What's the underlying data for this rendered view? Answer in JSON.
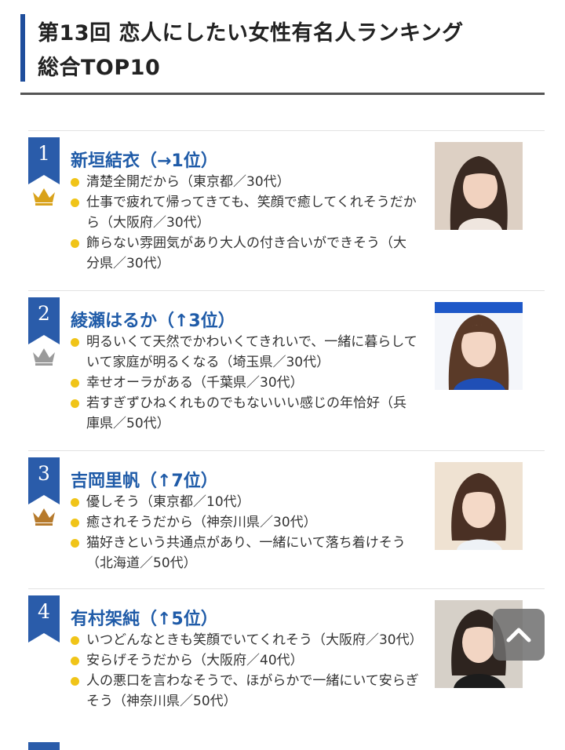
{
  "header": {
    "title_line1": "第13回 恋人にしたい女性有名人ランキング",
    "title_line2": "総合TOP10"
  },
  "colors": {
    "accent_blue": "#2a5caa",
    "name_blue": "#1f5ba8",
    "bullet_yellow": "#f0c418",
    "crown_gold": "#d9a21b",
    "crown_silver": "#9a9a9a",
    "crown_bronze": "#b67a2c"
  },
  "entries": [
    {
      "rank": "1",
      "name": "新垣結衣（→1位）",
      "crown": "gold-crown-icon",
      "comments": [
        "清楚全開だから（東京都／30代）",
        "仕事で疲れて帰ってきても、笑顔で癒してくれそうだから（大阪府／30代）",
        "飾らない雰囲気があり大人の付き合いができそう（大分県／30代）"
      ]
    },
    {
      "rank": "2",
      "name": "綾瀬はるか（↑3位）",
      "crown": "silver-crown-icon",
      "comments": [
        "明るいくて天然でかわいくてきれいで、一緒に暮らしていて家庭が明るくなる（埼玉県／30代）",
        "幸せオーラがある（千葉県／30代）",
        "若すぎずひねくれものでもないいい感じの年恰好（兵庫県／50代）"
      ]
    },
    {
      "rank": "3",
      "name": "吉岡里帆（↑7位）",
      "crown": "bronze-crown-icon",
      "comments": [
        "優しそう（東京都／10代）",
        "癒されそうだから（神奈川県／30代）",
        "猫好きという共通点があり、一緒にいて落ち着けそう（北海道／50代）"
      ]
    },
    {
      "rank": "4",
      "name": "有村架純（↑5位）",
      "crown": "",
      "comments": [
        "いつどんなときも笑顔でいてくれそう（大阪府／30代）",
        "安らげそうだから（大阪府／40代）",
        "人の悪口を言わなそうで、ほがらかで一緒にいて安らぎそう（神奈川県／50代）"
      ]
    }
  ],
  "scroll_top_icon": "chevron-up-icon"
}
